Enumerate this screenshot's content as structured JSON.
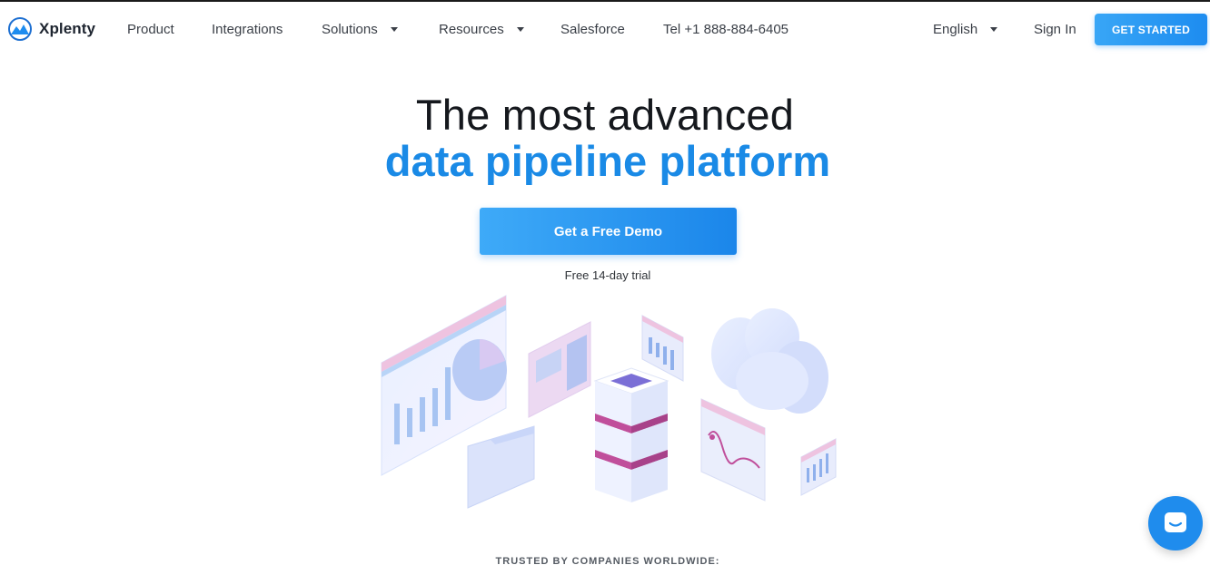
{
  "brand": {
    "name": "Xplenty",
    "logo_icon": "mountain-logo-icon"
  },
  "nav": {
    "items": [
      {
        "label": "Product",
        "has_dropdown": false
      },
      {
        "label": "Integrations",
        "has_dropdown": false
      },
      {
        "label": "Solutions",
        "has_dropdown": true
      },
      {
        "label": "Resources",
        "has_dropdown": true
      },
      {
        "label": "Salesforce",
        "has_dropdown": false
      },
      {
        "label": "Tel +1 888-884-6405",
        "has_dropdown": false
      }
    ],
    "language": "English",
    "sign_in": "Sign In",
    "get_started": "GET STARTED"
  },
  "hero": {
    "line1": "The most advanced",
    "line2": "data pipeline platform",
    "demo_button": "Get a Free Demo",
    "trial_note": "Free 14-day trial"
  },
  "trusted": "TRUSTED BY COMPANIES WORLDWIDE:",
  "chat": {
    "icon": "chat-bubble-icon"
  },
  "colors": {
    "accent": "#1a8ae6",
    "button_start": "#3eaaf8",
    "button_end": "#1b86ea",
    "text": "#15181d"
  }
}
